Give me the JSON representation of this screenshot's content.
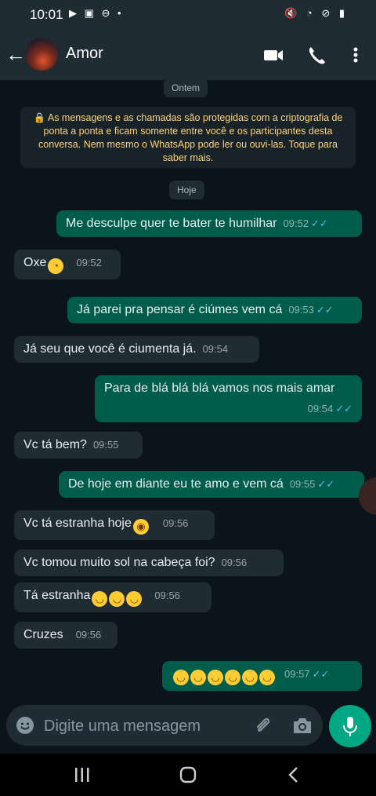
{
  "status_bar": {
    "time": "10:01"
  },
  "header": {
    "contact_name": "Amor"
  },
  "chat": {
    "date_chip_1": "Ontem",
    "encryption_notice": "🔒 As mensagens e as chamadas são protegidas com a criptografia de ponta a ponta e ficam somente entre você e os participantes desta conversa. Nem mesmo o WhatsApp pode ler ou ouvi-las. Toque para saber mais.",
    "date_chip_2": "Hoje",
    "messages": [
      {
        "dir": "out",
        "text": "Me desculpe quer te bater te  humilhar",
        "time": "09:52"
      },
      {
        "dir": "in",
        "text": "Oxe",
        "time": "09:52"
      },
      {
        "dir": "out",
        "text": "Já parei pra pensar é ciúmes vem cá",
        "time": "09:53"
      },
      {
        "dir": "in",
        "text": "Já seu que você é ciumenta já.",
        "time": "09:54"
      },
      {
        "dir": "out",
        "text": "Para de blá blá blá vamos nos mais amar",
        "time": "09:54"
      },
      {
        "dir": "in",
        "text": "Vc tá bem?",
        "time": "09:55"
      },
      {
        "dir": "out",
        "text": "De hoje em diante eu te amo e vem cá",
        "time": "09:55"
      },
      {
        "dir": "in",
        "text": "Vc tá estranha hoje",
        "time": "09:56"
      },
      {
        "dir": "in",
        "text": "Vc tomou muito sol na cabeça foi?",
        "time": "09:56"
      },
      {
        "dir": "in",
        "text": "Tá estranha",
        "time": "09:56"
      },
      {
        "dir": "in",
        "text": "Cruzes",
        "time": "09:56"
      },
      {
        "dir": "out",
        "text": "",
        "time": "09:57"
      }
    ]
  },
  "input": {
    "placeholder": "Digite uma mensagem"
  },
  "icons": {
    "back": "arrow-left-icon",
    "video": "video-call-icon",
    "phone": "phone-icon",
    "menu": "more-vert-icon",
    "emoji": "emoji-icon",
    "attach": "paperclip-icon",
    "camera": "camera-icon",
    "mic": "mic-icon",
    "read_receipt": "double-check-icon"
  },
  "colors": {
    "header_bg": "#1f2c34",
    "chat_bg": "#0b141a",
    "incoming_bubble": "#202c33",
    "outgoing_bubble": "#005c4b",
    "read_tick": "#53bdeb",
    "accent": "#00a884",
    "notice_text": "#ffd279"
  }
}
